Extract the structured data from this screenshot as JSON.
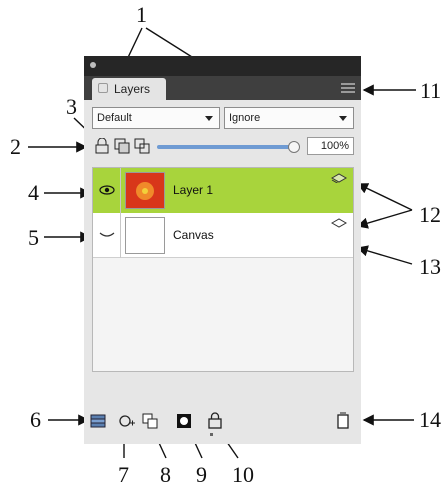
{
  "callouts": {
    "n1": "1",
    "n2": "2",
    "n3": "3",
    "n4": "4",
    "n5": "5",
    "n6": "6",
    "n7": "7",
    "n8": "8",
    "n9": "9",
    "n10": "10",
    "n11": "11",
    "n12": "12",
    "n13": "13",
    "n14": "14"
  },
  "panel": {
    "tab_label": "Layers",
    "composite_method": "Default",
    "merge_mode": "Ignore",
    "opacity": "100%",
    "opacity_level": 1.0
  },
  "layers": [
    {
      "name": "Layer 1",
      "selected": true,
      "visible": true,
      "thumbnail": "red-flower"
    },
    {
      "name": "Canvas",
      "selected": false,
      "visible": false,
      "thumbnail": "blank"
    }
  ],
  "icons": {
    "tab_close": "close-icon",
    "panel_menu": "panel-menu-icon",
    "object_lock": "lock-icon",
    "eye": "eye-icon",
    "layer_type": "layer-icon",
    "stack": "stack-icon"
  },
  "colors": {
    "selected_row": "#a8d43c",
    "slider": "#6f9bd3",
    "panel_dark": "#3f3f3f",
    "panel_light": "#e6e6e6"
  }
}
